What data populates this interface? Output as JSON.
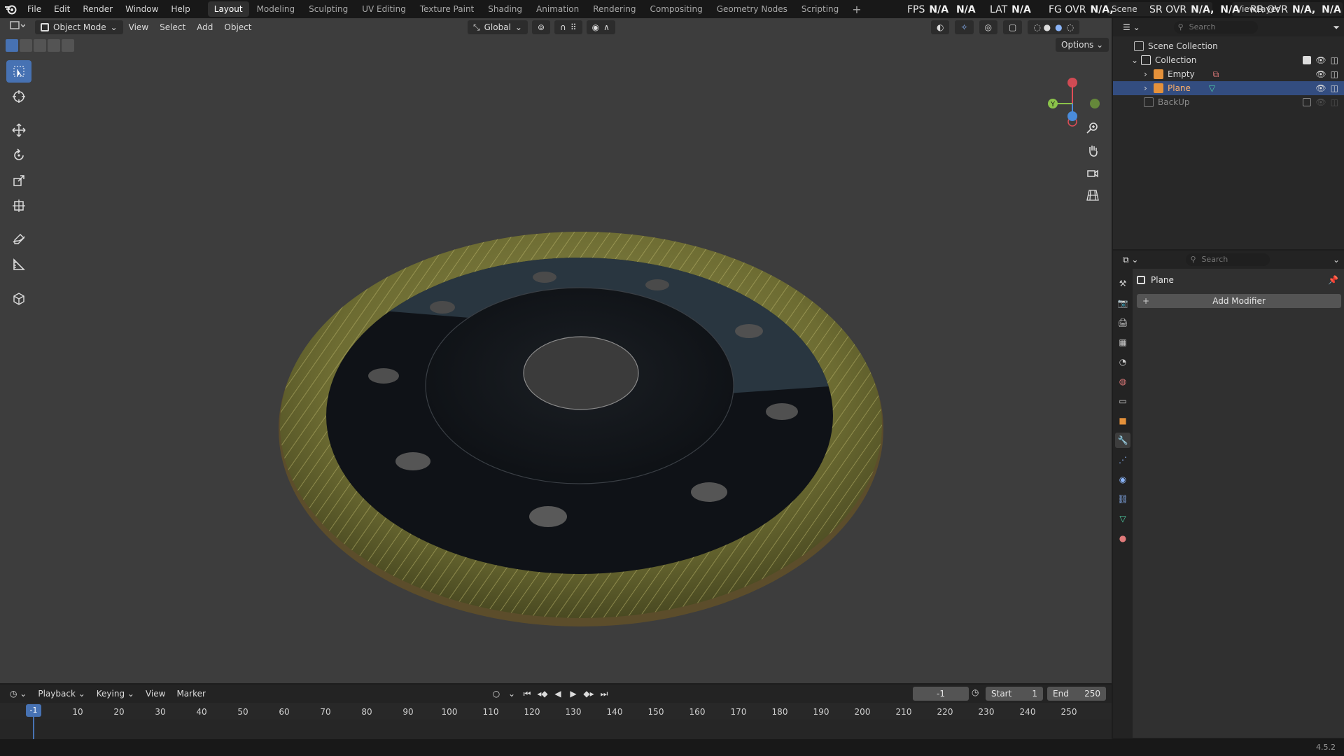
{
  "menu": {
    "items": [
      "File",
      "Edit",
      "Render",
      "Window",
      "Help"
    ]
  },
  "workspaces": {
    "tabs": [
      "Layout",
      "Modeling",
      "Sculpting",
      "UV Editing",
      "Texture Paint",
      "Shading",
      "Animation",
      "Rendering",
      "Compositing",
      "Geometry Nodes",
      "Scripting"
    ],
    "active": "Layout",
    "add_label": "+"
  },
  "stats": {
    "fps_label": "FPS",
    "fps_value": "N/A",
    "fps_value2": "N/A",
    "lat_label": "LAT",
    "lat_value": "N/A",
    "fg_label": "FG OVR",
    "fg_value": "N/A,",
    "sr_label": "SR OVR",
    "sr_value": "N/A,",
    "sr_value2": "N/A",
    "rr_label": "RR OVR",
    "rr_value": "N/A,",
    "rr_value2": "N/A"
  },
  "scene": {
    "label": "Scene"
  },
  "view_layer": {
    "label": "ViewLayer"
  },
  "viewport": {
    "mode": "Object Mode",
    "menus": [
      "View",
      "Select",
      "Add",
      "Object"
    ],
    "orientation": "Global",
    "options_label": "Options",
    "gizmo_axes": {
      "y": "Y"
    }
  },
  "outliner": {
    "search_placeholder": "Search",
    "rows": [
      {
        "name": "Scene Collection"
      },
      {
        "name": "Collection"
      },
      {
        "name": "Empty"
      },
      {
        "name": "Plane"
      },
      {
        "name": "BackUp"
      }
    ],
    "selected": "Plane"
  },
  "properties": {
    "search_placeholder": "Search",
    "object_name": "Plane",
    "add_modifier_label": "Add Modifier",
    "active_tab": "modifier"
  },
  "timeline": {
    "menus": [
      "Playback",
      "Keying",
      "View",
      "Marker"
    ],
    "current_frame": "-1",
    "start_label": "Start",
    "start_value": "1",
    "end_label": "End",
    "end_value": "250",
    "ticks": [
      "10",
      "20",
      "30",
      "40",
      "50",
      "60",
      "70",
      "80",
      "90",
      "100",
      "110",
      "120",
      "130",
      "140",
      "150",
      "160",
      "170",
      "180",
      "190",
      "200",
      "210",
      "220",
      "230",
      "240",
      "250"
    ],
    "playhead_label": "-1"
  },
  "status": {
    "version": "4.5.2"
  },
  "colors": {
    "accent": "#4772b3",
    "selected_row": "#334d80",
    "viewport_bg": "#3d3d3d",
    "axis_x": "#e04d57",
    "axis_y": "#8bc34a",
    "axis_z": "#4a8cdb"
  }
}
